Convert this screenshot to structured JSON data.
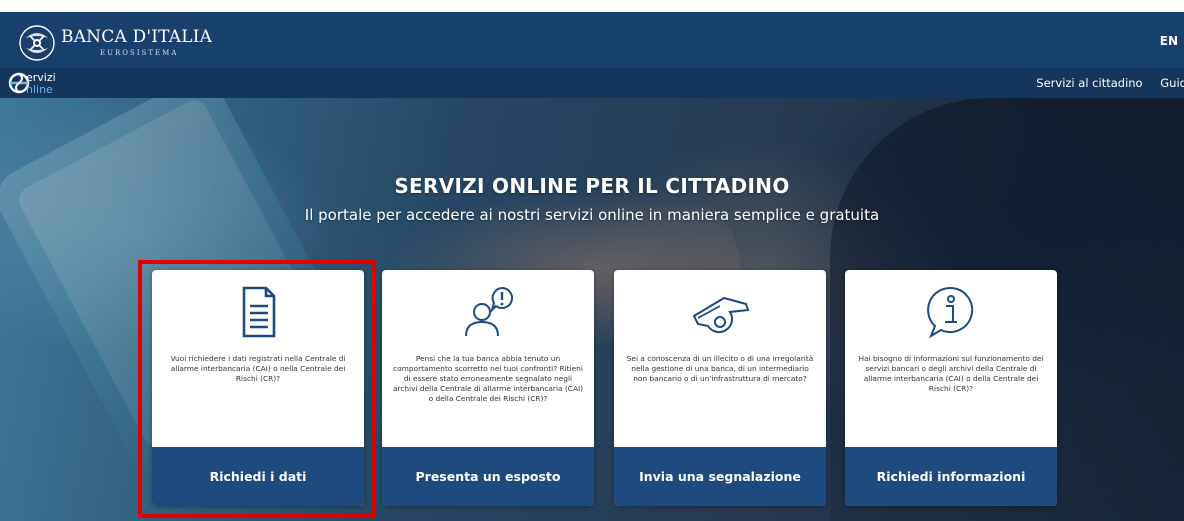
{
  "header": {
    "logo_name": "BANCA D'ITALIA",
    "logo_subtitle": "EUROSISTEMA",
    "language": "EN"
  },
  "subnav": {
    "logo_word1": "ervizi",
    "logo_word2": "nline",
    "links": [
      "Servizi al cittadino",
      "Guida"
    ]
  },
  "hero": {
    "title": "SERVIZI ONLINE PER IL CITTADINO",
    "subtitle": "Il portale per accedere ai nostri servizi online in maniera semplice e gratuita"
  },
  "cards": [
    {
      "icon": "document-icon",
      "text": "Vuoi richiedere i dati registrati nella Centrale di allarme interbancaria (CAI) o nella Centrale dei Rischi (CR)?",
      "button": "Richiedi i dati"
    },
    {
      "icon": "person-alert-icon",
      "text": "Pensi che la tua banca abbia tenuto un comportamento scorretto nei tuoi confronti? Ritieni di essere stato erroneamente segnalato negli archivi della Centrale di allarme interbancaria (CAI) o della Centrale dei Rischi (CR)?",
      "button": "Presenta un esposto"
    },
    {
      "icon": "whistle-icon",
      "text": "Sei a conoscenza di un illecito o di una irregolarità nella gestione di una banca, di un intermediario non bancario o di un'infrastruttura di mercato?",
      "button": "Invia una segnalazione"
    },
    {
      "icon": "info-bubble-icon",
      "text": "Hai bisogno di informazioni sul funzionamento dei servizi bancari o degli archivi della Centrale di allarme interbancaria (CAI) o della Centrale dei Rischi (CR)?",
      "button": "Richiedi informazioni"
    }
  ],
  "colors": {
    "header_bg": "#18406e",
    "subnav_bg": "#14355c",
    "button_bg": "#1d4a7f",
    "highlight": "#e00000"
  }
}
